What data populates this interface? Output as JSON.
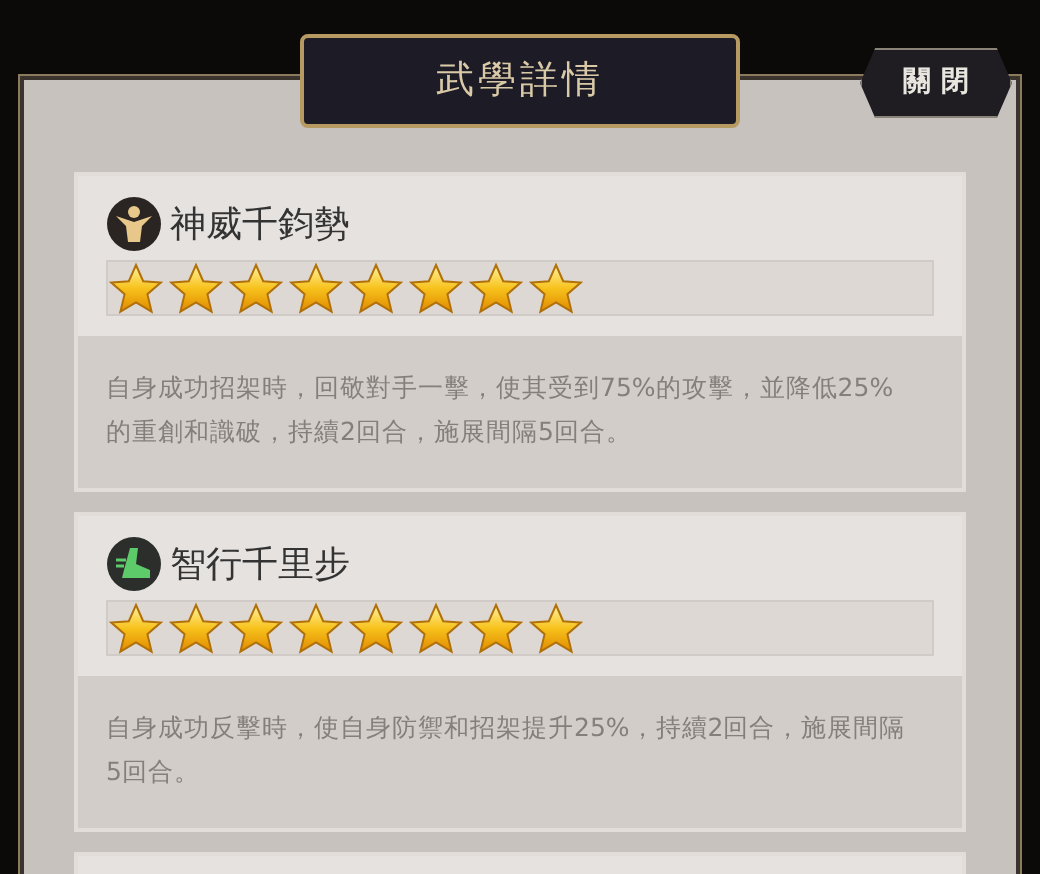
{
  "title": "武學詳情",
  "close_button": "關 閉",
  "skills": [
    {
      "kind": "figure",
      "name": "神威千鈞勢",
      "stars": 8,
      "description": "自身成功招架時，回敬對手一擊，使其受到75%的攻擊，並降低25%的重創和識破，持續2回合，施展間隔5回合。"
    },
    {
      "kind": "boot",
      "name": "智行千里步",
      "stars": 8,
      "description": "自身成功反擊時，使自身防禦和招架提升25%，持續2回合，施展間隔5回合。"
    }
  ]
}
